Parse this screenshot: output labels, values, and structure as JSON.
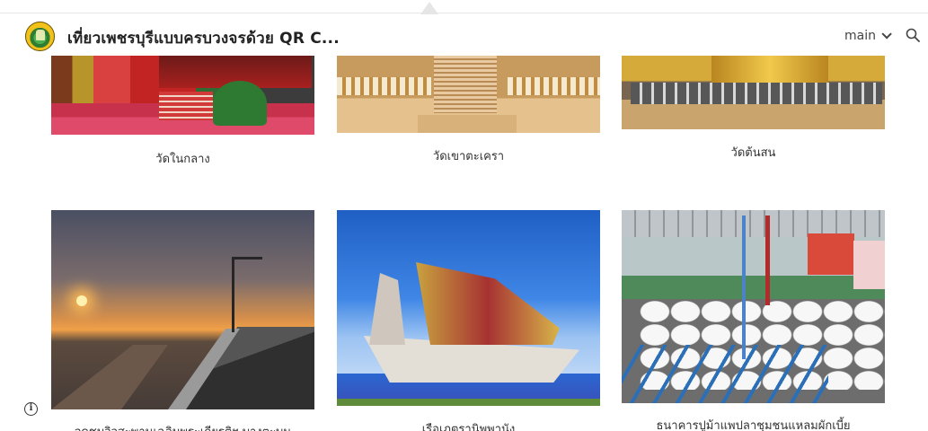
{
  "header": {
    "site_title": "เที่ยวเพชรบุรีแบบครบวงจรด้วย QR C...",
    "nav_main_label": "main",
    "icons": {
      "logo": "provincial-seal-logo",
      "dropdown": "chevron-down-icon",
      "search": "search-icon",
      "info": "info-icon"
    }
  },
  "gallery": {
    "items": [
      {
        "caption": "วัดในกลาง"
      },
      {
        "caption": "วัดเขาตะเครา"
      },
      {
        "caption": "วัดต้นสน"
      },
      {
        "caption": "จุดชมวิวสะพานเฉลิมพระเกียรติฯ บางตะบูน"
      },
      {
        "caption": "เรือเภตรานิพพานัง"
      },
      {
        "caption": "ธนาคารปูม้าแพปลาชุมชนแหลมผักเบี้ย"
      }
    ]
  }
}
